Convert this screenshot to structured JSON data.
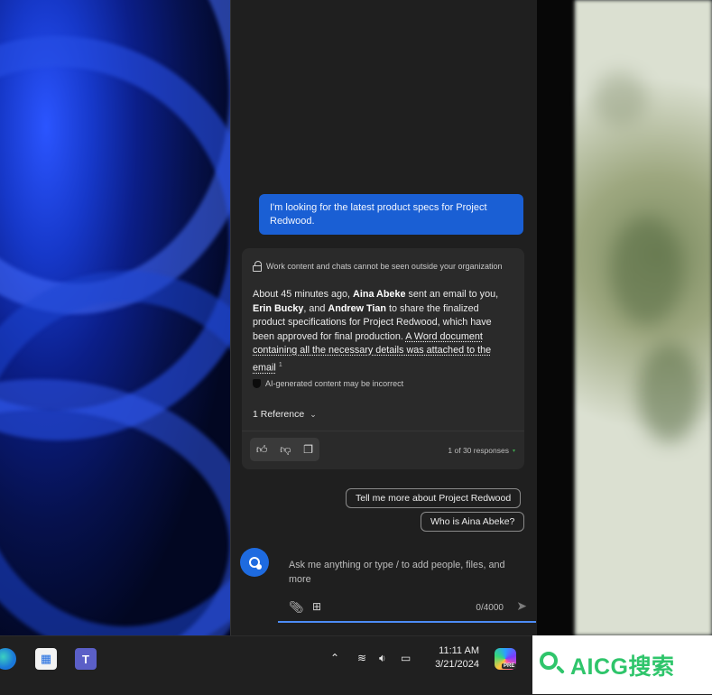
{
  "chat": {
    "user_message": "I'm looking for the latest product specs for Project Redwood.",
    "privacy_note": "Work content and chats cannot be seen outside your organization",
    "answer": {
      "p1": "About 45 minutes ago, ",
      "name1": "Aina Abeke",
      "p2": " sent an email to you, ",
      "name2": "Erin Bucky",
      "p3": ", and ",
      "name3": "Andrew Tian",
      "p4": " to share the finalized product specifications for Project Redwood, which have been approved for final production. ",
      "link": "A Word document containing all the necessary details was attached to the email",
      "citation": "1"
    },
    "ai_note": "AI-generated content may be incorrect",
    "reference_label": "1 Reference",
    "responses_count": "1 of 30 responses",
    "suggestions": [
      "Tell me more about Project Redwood",
      "Who is Aina Abeke?"
    ]
  },
  "composer": {
    "placeholder": "Ask me anything or type / to add people, files, and more",
    "counter": "0/4000"
  },
  "taskbar": {
    "time": "11:11 AM",
    "date": "3/21/2024",
    "copilot_badge": "PRE"
  },
  "watermark": {
    "text": "AICG搜索"
  },
  "colors": {
    "accent": "#1a5fd4",
    "pane_bg": "#1f1f1f",
    "brand_green": "#2fc56b"
  }
}
